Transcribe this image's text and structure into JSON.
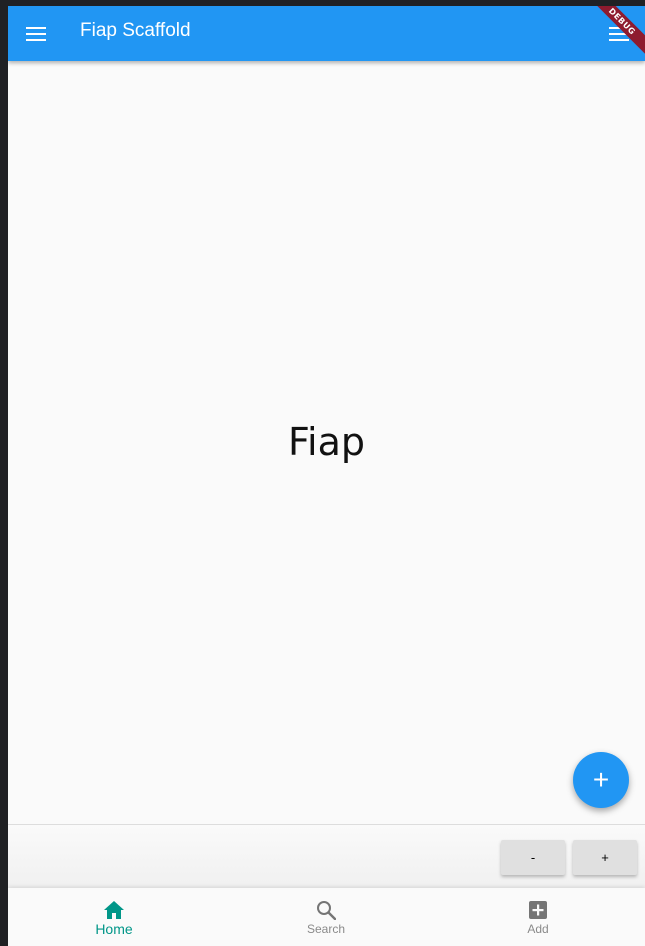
{
  "app_bar": {
    "title": "Fiap Scaffold",
    "leading_icon": "menu-icon",
    "trailing_icon": "menu-icon",
    "color": "#2196f3"
  },
  "debug_banner": {
    "label": "DEBUG",
    "color": "#8e1b2f"
  },
  "body": {
    "text": "Fiap"
  },
  "fab": {
    "label": "+",
    "icon": "add-icon",
    "color": "#2196f3"
  },
  "footer_buttons": {
    "minus_label": "-",
    "plus_label": "+"
  },
  "bottom_nav": {
    "active_color": "#009688",
    "inactive_color": "#8a8a8a",
    "items": [
      {
        "label": "Home",
        "icon": "home-icon",
        "active": true
      },
      {
        "label": "Search",
        "icon": "search-icon",
        "active": false
      },
      {
        "label": "Add",
        "icon": "add-box-icon",
        "active": false
      }
    ]
  }
}
